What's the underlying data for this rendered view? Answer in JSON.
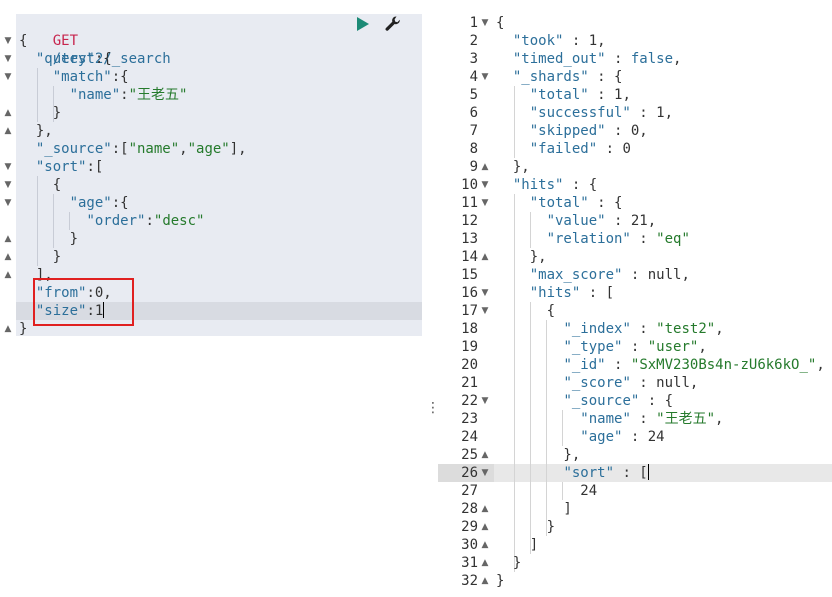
{
  "request": {
    "method": "GET",
    "path": "/test2/_search",
    "lines": [
      [
        [
          "p",
          "{"
        ]
      ],
      [
        [
          "p",
          "  "
        ],
        [
          "k",
          "\"query\""
        ],
        [
          "p",
          ":{"
        ]
      ],
      [
        [
          "p",
          "    "
        ],
        [
          "k",
          "\"match\""
        ],
        [
          "p",
          ":{"
        ]
      ],
      [
        [
          "p",
          "      "
        ],
        [
          "k",
          "\"name\""
        ],
        [
          "p",
          ":"
        ],
        [
          "s",
          "\"王老五\""
        ]
      ],
      [
        [
          "p",
          "    }"
        ]
      ],
      [
        [
          "p",
          "  },"
        ]
      ],
      [
        [
          "p",
          "  "
        ],
        [
          "k",
          "\"_source\""
        ],
        [
          "p",
          ":["
        ],
        [
          "s",
          "\"name\""
        ],
        [
          "p",
          ","
        ],
        [
          "s",
          "\"age\""
        ],
        [
          "p",
          "],"
        ]
      ],
      [
        [
          "p",
          "  "
        ],
        [
          "k",
          "\"sort\""
        ],
        [
          "p",
          ":["
        ]
      ],
      [
        [
          "p",
          "    {"
        ]
      ],
      [
        [
          "p",
          "      "
        ],
        [
          "k",
          "\"age\""
        ],
        [
          "p",
          ":{"
        ]
      ],
      [
        [
          "p",
          "        "
        ],
        [
          "k",
          "\"order\""
        ],
        [
          "p",
          ":"
        ],
        [
          "s",
          "\"desc\""
        ]
      ],
      [
        [
          "p",
          "      }"
        ]
      ],
      [
        [
          "p",
          "    }"
        ]
      ],
      [
        [
          "p",
          "  ],"
        ]
      ],
      [
        [
          "p",
          "  "
        ],
        [
          "k",
          "\"from\""
        ],
        [
          "p",
          ":0,"
        ]
      ],
      [
        [
          "p",
          "  "
        ],
        [
          "k",
          "\"size\""
        ],
        [
          "p",
          ":1"
        ]
      ],
      [
        [
          "p",
          "}"
        ]
      ]
    ]
  },
  "response": {
    "line_numbers": [
      "1",
      "2",
      "3",
      "4",
      "5",
      "6",
      "7",
      "8",
      "9",
      "10",
      "11",
      "12",
      "13",
      "14",
      "15",
      "16",
      "17",
      "18",
      "19",
      "20",
      "21",
      "22",
      "23",
      "24",
      "25",
      "26",
      "27",
      "28",
      "29",
      "30",
      "31",
      "32"
    ],
    "lines": [
      [
        [
          "p",
          "{"
        ]
      ],
      [
        [
          "p",
          "  "
        ],
        [
          "k",
          "\"took\""
        ],
        [
          "p",
          " : 1,"
        ]
      ],
      [
        [
          "p",
          "  "
        ],
        [
          "k",
          "\"timed_out\""
        ],
        [
          "p",
          " : "
        ],
        [
          "v",
          "false"
        ],
        [
          "p",
          ","
        ]
      ],
      [
        [
          "p",
          "  "
        ],
        [
          "k",
          "\"_shards\""
        ],
        [
          "p",
          " : {"
        ]
      ],
      [
        [
          "p",
          "    "
        ],
        [
          "k",
          "\"total\""
        ],
        [
          "p",
          " : 1,"
        ]
      ],
      [
        [
          "p",
          "    "
        ],
        [
          "k",
          "\"successful\""
        ],
        [
          "p",
          " : 1,"
        ]
      ],
      [
        [
          "p",
          "    "
        ],
        [
          "k",
          "\"skipped\""
        ],
        [
          "p",
          " : 0,"
        ]
      ],
      [
        [
          "p",
          "    "
        ],
        [
          "k",
          "\"failed\""
        ],
        [
          "p",
          " : 0"
        ]
      ],
      [
        [
          "p",
          "  },"
        ]
      ],
      [
        [
          "p",
          "  "
        ],
        [
          "k",
          "\"hits\""
        ],
        [
          "p",
          " : {"
        ]
      ],
      [
        [
          "p",
          "    "
        ],
        [
          "k",
          "\"total\""
        ],
        [
          "p",
          " : {"
        ]
      ],
      [
        [
          "p",
          "      "
        ],
        [
          "k",
          "\"value\""
        ],
        [
          "p",
          " : 21,"
        ]
      ],
      [
        [
          "p",
          "      "
        ],
        [
          "k",
          "\"relation\""
        ],
        [
          "p",
          " : "
        ],
        [
          "s",
          "\"eq\""
        ]
      ],
      [
        [
          "p",
          "    },"
        ]
      ],
      [
        [
          "p",
          "    "
        ],
        [
          "k",
          "\"max_score\""
        ],
        [
          "p",
          " : null,"
        ]
      ],
      [
        [
          "p",
          "    "
        ],
        [
          "k",
          "\"hits\""
        ],
        [
          "p",
          " : ["
        ]
      ],
      [
        [
          "p",
          "      {"
        ]
      ],
      [
        [
          "p",
          "        "
        ],
        [
          "k",
          "\"_index\""
        ],
        [
          "p",
          " : "
        ],
        [
          "s",
          "\"test2\""
        ],
        [
          "p",
          ","
        ]
      ],
      [
        [
          "p",
          "        "
        ],
        [
          "k",
          "\"_type\""
        ],
        [
          "p",
          " : "
        ],
        [
          "s",
          "\"user\""
        ],
        [
          "p",
          ","
        ]
      ],
      [
        [
          "p",
          "        "
        ],
        [
          "k",
          "\"_id\""
        ],
        [
          "p",
          " : "
        ],
        [
          "s",
          "\"SxMV230Bs4n-zU6k6kO_\""
        ],
        [
          "p",
          ","
        ]
      ],
      [
        [
          "p",
          "        "
        ],
        [
          "k",
          "\"_score\""
        ],
        [
          "p",
          " : null,"
        ]
      ],
      [
        [
          "p",
          "        "
        ],
        [
          "k",
          "\"_source\""
        ],
        [
          "p",
          " : {"
        ]
      ],
      [
        [
          "p",
          "          "
        ],
        [
          "k",
          "\"name\""
        ],
        [
          "p",
          " : "
        ],
        [
          "s",
          "\"王老五\""
        ],
        [
          "p",
          ","
        ]
      ],
      [
        [
          "p",
          "          "
        ],
        [
          "k",
          "\"age\""
        ],
        [
          "p",
          " : 24"
        ]
      ],
      [
        [
          "p",
          "        },"
        ]
      ],
      [
        [
          "p",
          "        "
        ],
        [
          "k",
          "\"sort\""
        ],
        [
          "p",
          " : ["
        ]
      ],
      [
        [
          "p",
          "          24"
        ]
      ],
      [
        [
          "p",
          "        ]"
        ]
      ],
      [
        [
          "p",
          "      }"
        ]
      ],
      [
        [
          "p",
          "    ]"
        ]
      ],
      [
        [
          "p",
          "  }"
        ]
      ],
      [
        [
          "p",
          "}"
        ]
      ]
    ]
  },
  "colors": {
    "method": "#c7254e",
    "key": "#2c6f9a",
    "string": "#257a2c",
    "run": "#1c8a76",
    "highlight": "#e02020"
  },
  "icons": {
    "run": "play-icon",
    "settings": "wrench-icon",
    "resize": "vertical-dots-icon"
  }
}
